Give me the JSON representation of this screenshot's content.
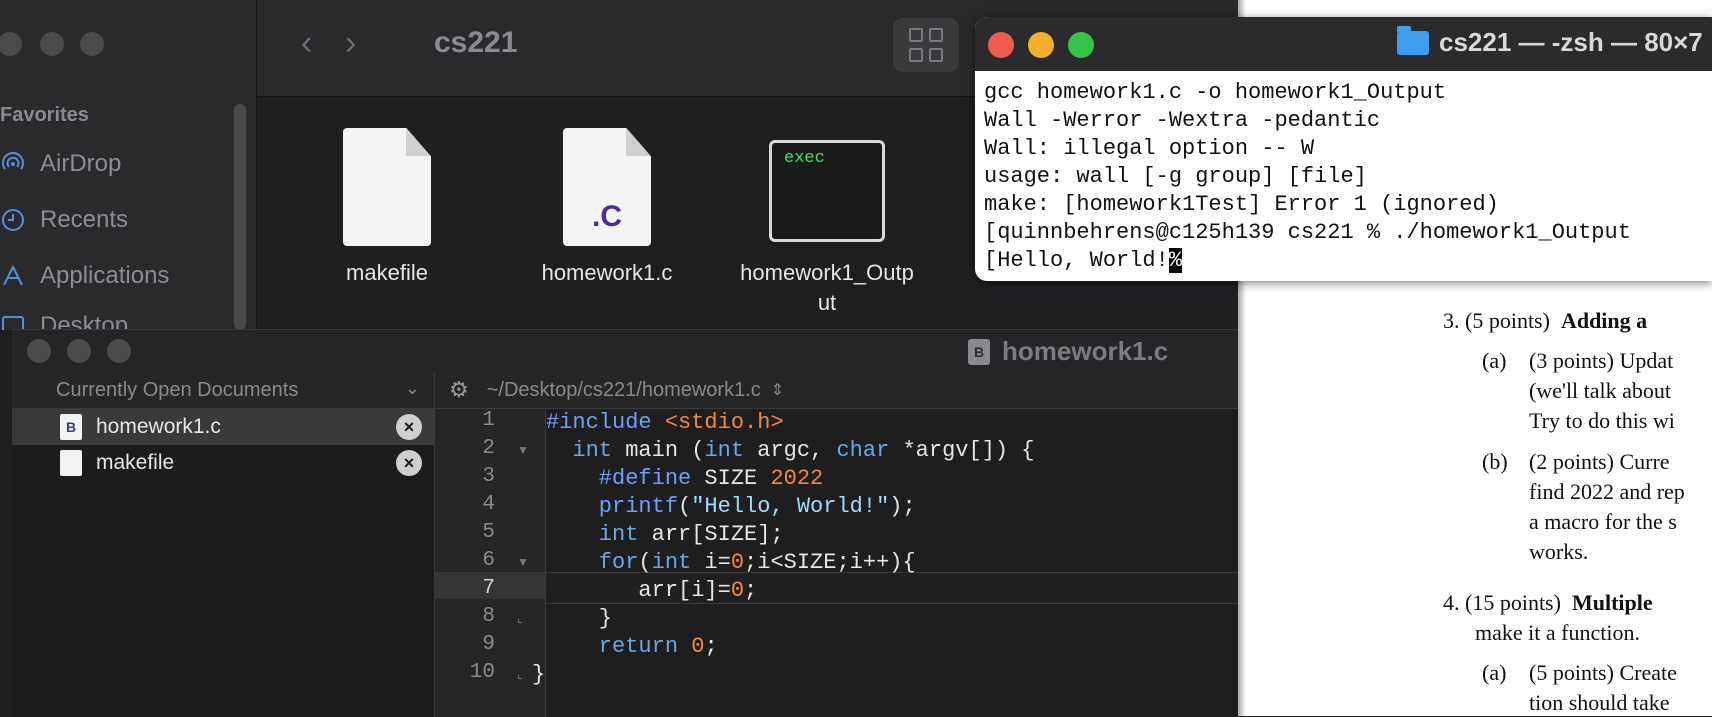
{
  "finder": {
    "title": "cs221",
    "sidebar": {
      "favorites_label": "Favorites",
      "items": [
        {
          "label": "AirDrop",
          "icon": "airdrop-icon"
        },
        {
          "label": "Recents",
          "icon": "clock-icon"
        },
        {
          "label": "Applications",
          "icon": "applications-icon"
        },
        {
          "label": "Desktop",
          "icon": "desktop-icon"
        }
      ]
    },
    "files": [
      {
        "name": "makefile",
        "icon": "document-icon"
      },
      {
        "name": "homework1.c",
        "icon": "c-source-icon",
        "badge": ".C"
      },
      {
        "name": "homework1_Outp",
        "name2": "ut",
        "icon": "exec-icon",
        "badge": "exec"
      }
    ]
  },
  "terminal": {
    "title": "cs221 — -zsh — 80×7",
    "lines": [
      "gcc homework1.c -o homework1_Output",
      "Wall -Werror -Wextra -pedantic",
      "Wall: illegal option -- W",
      "usage: wall [-g group] [file]",
      "make: [homework1Test] Error 1 (ignored)",
      "[quinnbehrens@c125h139 cs221 % ./homework1_Output",
      "[Hello, World!",
      "%"
    ]
  },
  "editor": {
    "title": "homework1.c",
    "documents_header": "Currently Open Documents",
    "documents": [
      {
        "name": "homework1.c",
        "selected": true
      },
      {
        "name": "makefile",
        "selected": false
      }
    ],
    "path": "~/Desktop/cs221/homework1.c",
    "line_numbers": [
      "1",
      "2",
      "3",
      "4",
      "5",
      "6",
      "7",
      "8",
      "9",
      "10"
    ],
    "code": {
      "l1_a": "#include",
      "l1_b": " <stdio.h>",
      "l2_a": "  int",
      "l2_b": " main (",
      "l2_c": "int",
      "l2_d": " argc, ",
      "l2_e": "char",
      "l2_f": " *argv[]) {",
      "l3_a": "    #define",
      "l3_b": " SIZE ",
      "l3_c": "2022",
      "l4_a": "    printf",
      "l4_b": "(",
      "l4_c": "\"Hello, World!\"",
      "l4_d": ");",
      "l5_a": "    int",
      "l5_b": " arr[SIZE];",
      "l6_a": "    for",
      "l6_b": "(",
      "l6_c": "int",
      "l6_d": " i=",
      "l6_e": "0",
      "l6_f": ";i<SIZE;i++){",
      "l7_a": "       arr[i]=",
      "l7_b": "0",
      "l7_c": ";",
      "l8_a": "    }",
      "l9_a": "    return",
      "l9_b": " ",
      "l9_c": "0",
      "l9_d": ";",
      "l10_a": "}"
    }
  },
  "pdf": {
    "q3_num": "3.",
    "q3_pts": "(5 points)",
    "q3_title": "Adding a",
    "q3a_label": "(a)",
    "q3a_l1": "(3 points)  Updat",
    "q3a_l2": "(we'll talk about",
    "q3a_l3": "Try to do this wi",
    "q3b_label": "(b)",
    "q3b_l1": "(2 points)  Curre",
    "q3b_l2": "find 2022 and rep",
    "q3b_l3": "a macro for the s",
    "q3b_l4": "works.",
    "q4_num": "4.",
    "q4_pts": "(15 points)",
    "q4_title": "Multiple",
    "q4_l2": "make it a function.",
    "q4a_label": "(a)",
    "q4a_l1": "(5 points)  Create",
    "q4a_l2": "tion should take"
  }
}
